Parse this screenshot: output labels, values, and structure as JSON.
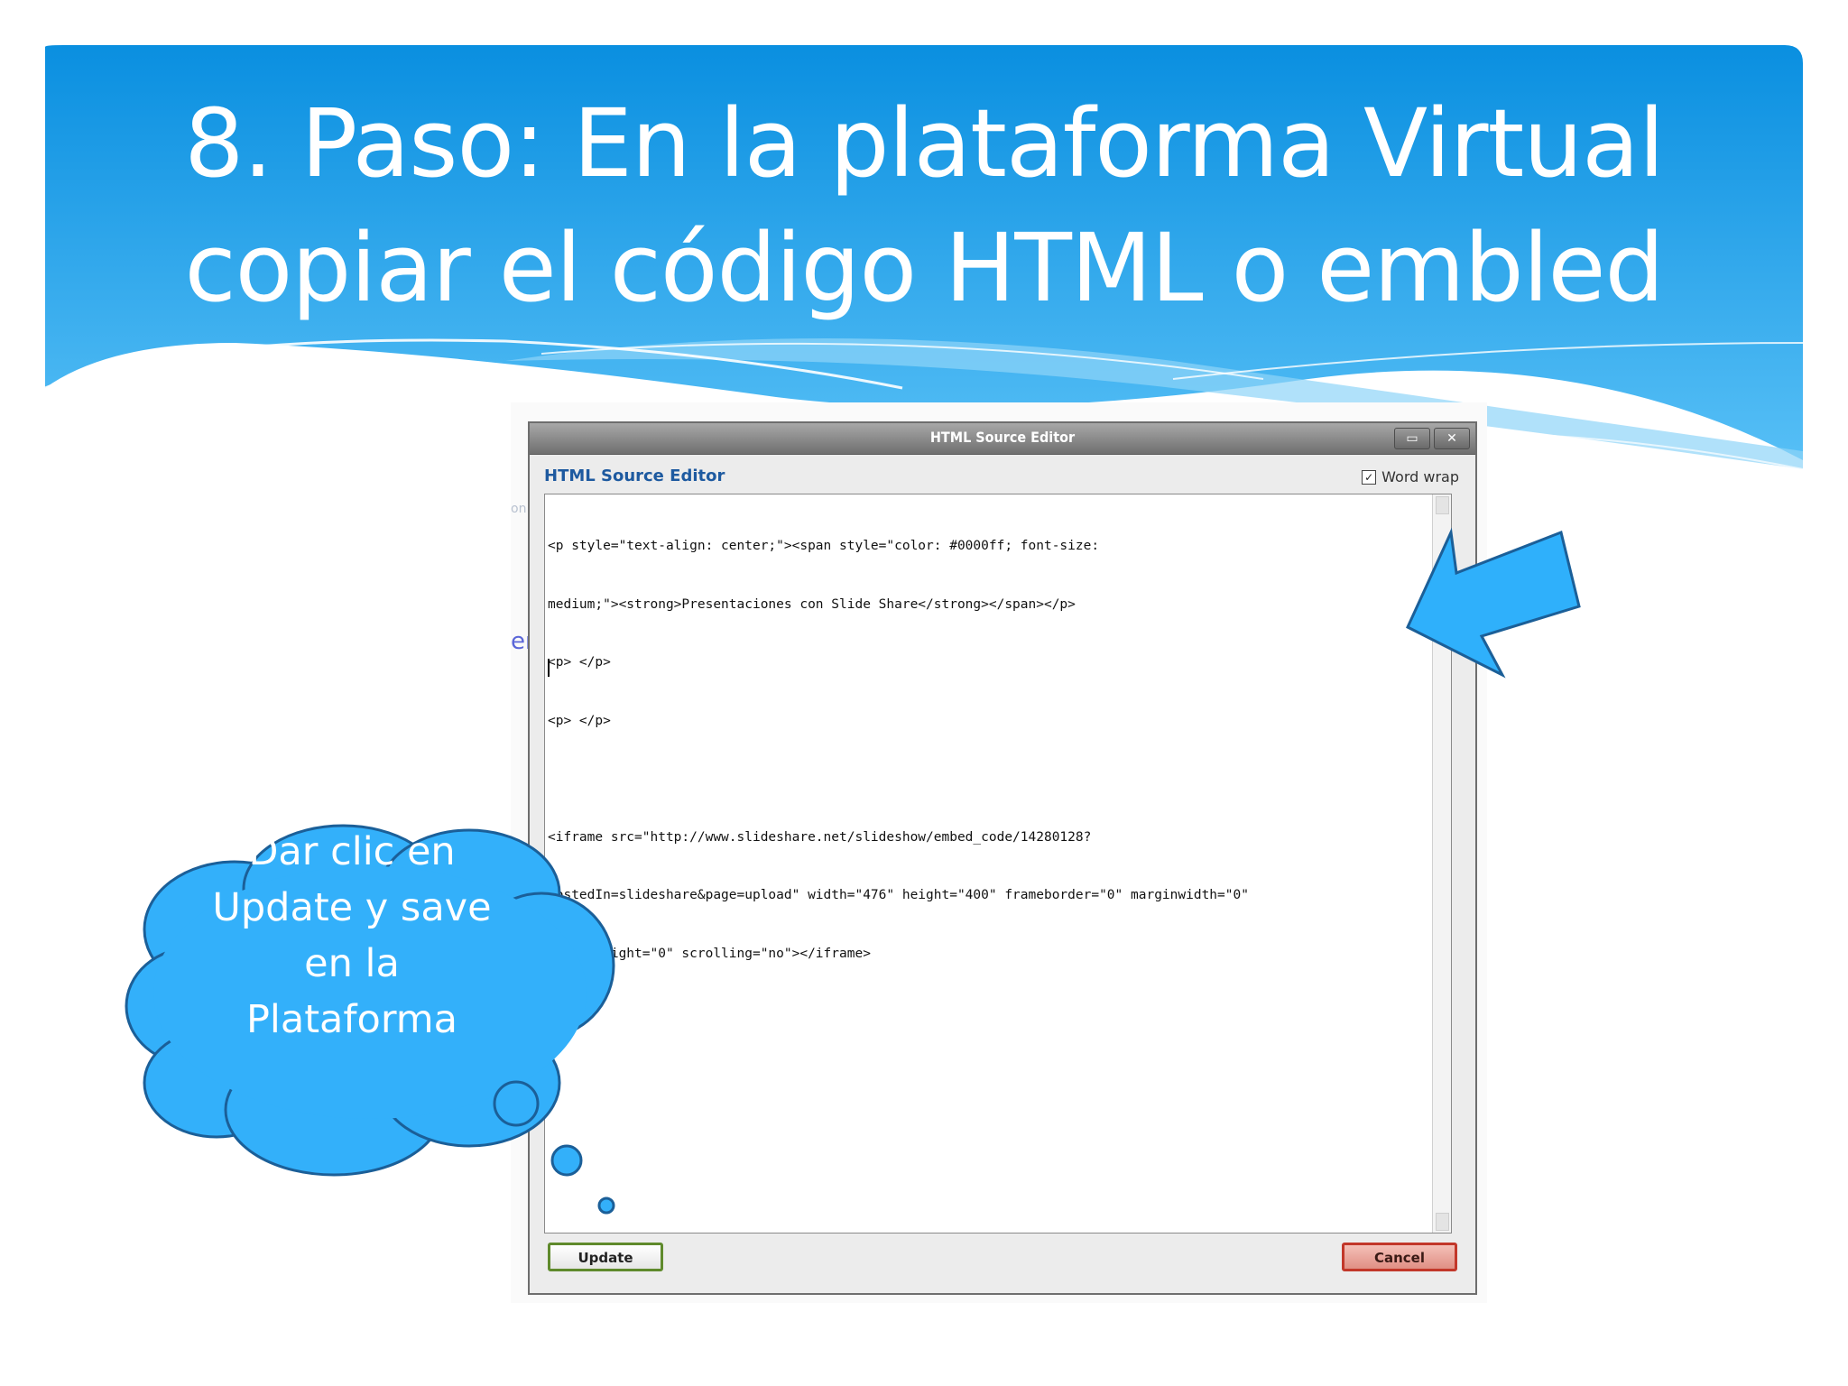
{
  "slide": {
    "title_line1": "8. Paso: En la plataforma Virtual",
    "title_line2": "copiar el código HTML o embled"
  },
  "dialog": {
    "window_title": "HTML Source Editor",
    "restore_label": "▭",
    "close_label": "✕",
    "header": "HTML Source Editor",
    "word_wrap_label": "Word wrap",
    "word_wrap_checked": "✓",
    "code_lines": [
      "<p style=\"text-align: center;\"><span style=\"color: #0000ff; font-size:",
      "medium;\"><strong>Presentaciones con Slide Share</strong></span></p>",
      "<p> </p>",
      "<p> </p>",
      "",
      "<iframe src=\"http://www.slideshare.net/slideshow/embed_code/14280128?",
      "hostedIn=slideshare&page=upload\" width=\"476\" height=\"400\" frameborder=\"0\" marginwidth=\"0\"",
      "marginheight=\"0\" scrolling=\"no\"></iframe>"
    ],
    "update_label": "Update",
    "cancel_label": "Cancel"
  },
  "callout": {
    "line1": "Dar clic en",
    "line2": "Update y save",
    "line3": "en la",
    "line4": "Plataforma"
  },
  "colors": {
    "banner_top": "#0a8fe0",
    "banner_bottom": "#55bdf5",
    "callout_fill": "#33b0fa",
    "callout_stroke": "#1b5f98",
    "arrow_fill": "#2fb0fb"
  }
}
